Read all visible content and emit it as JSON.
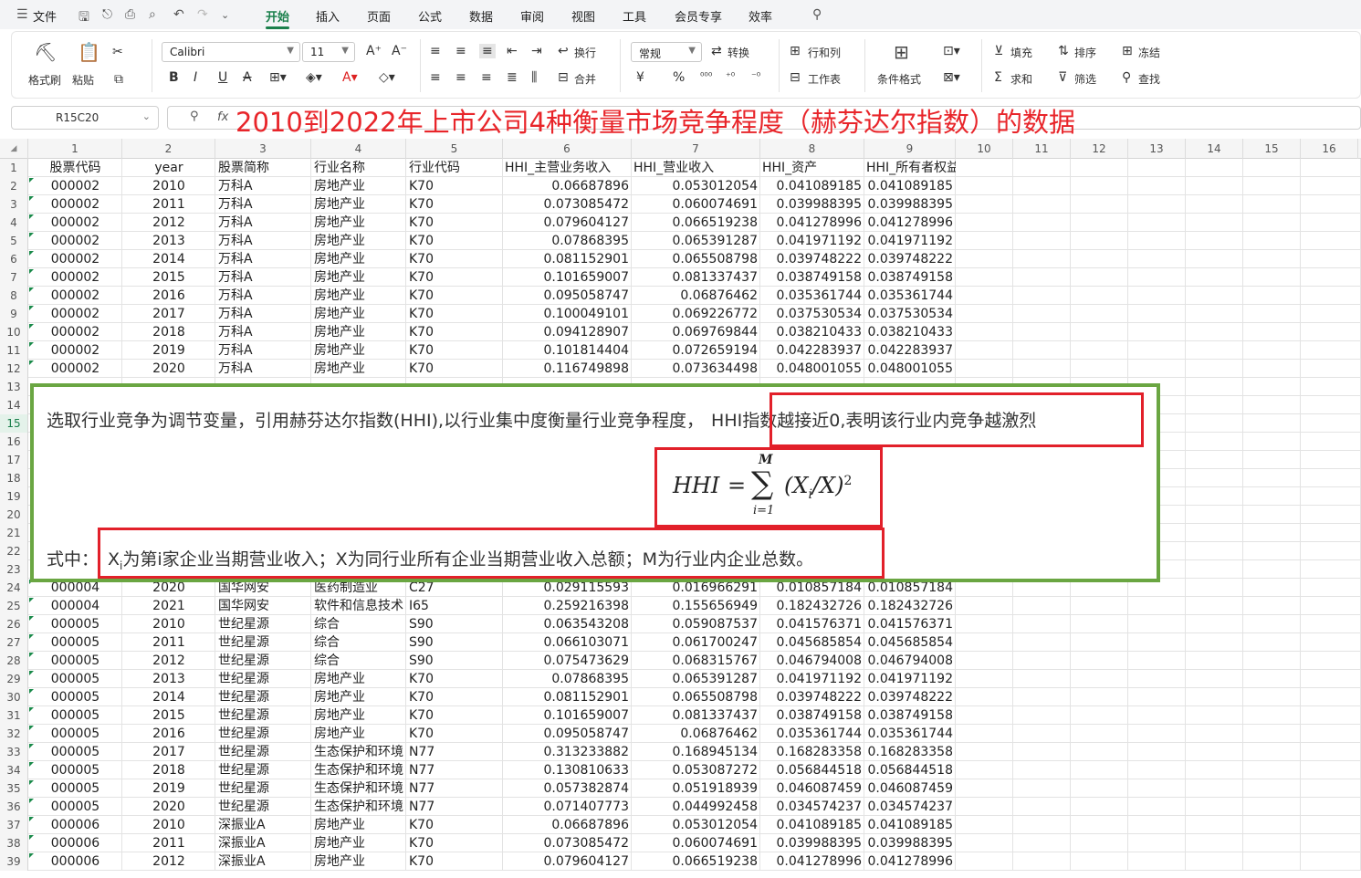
{
  "menu": {
    "file": "文件",
    "tabs": [
      "开始",
      "插入",
      "页面",
      "公式",
      "数据",
      "审阅",
      "视图",
      "工具",
      "会员专享",
      "效率"
    ],
    "active_tab": "开始"
  },
  "ribbon": {
    "format_painter": "格式刷",
    "paste": "粘贴",
    "font_name": "Calibri",
    "font_size": "11",
    "wrap": "换行",
    "merge": "合并",
    "number_format": "常规",
    "convert": "转换",
    "row_col": "行和列",
    "worksheet": "工作表",
    "cond_format": "条件格式",
    "fill": "填充",
    "sort": "排序",
    "freeze": "冻结",
    "sum": "求和",
    "filter": "筛选",
    "find": "查找",
    "yen": "¥",
    "percent": "%"
  },
  "formula_bar": {
    "name_box": "R15C20",
    "fx": "fx",
    "title": "2010到2022年上市公司4种衡量市场竞争程度（赫芬达尔指数）的数据"
  },
  "columns": [
    "1",
    "2",
    "3",
    "4",
    "5",
    "6",
    "7",
    "8",
    "9",
    "10",
    "11",
    "12",
    "13",
    "14",
    "15",
    "16"
  ],
  "row_numbers": [
    "1",
    "2",
    "3",
    "4",
    "5",
    "6",
    "7",
    "8",
    "9",
    "10",
    "11",
    "12",
    "13",
    "14",
    "15",
    "16",
    "17",
    "18",
    "19",
    "20",
    "21",
    "22",
    "23",
    "24",
    "25",
    "26",
    "27",
    "28",
    "29",
    "30",
    "31",
    "32",
    "33",
    "34",
    "35",
    "36",
    "37",
    "38",
    "39"
  ],
  "selected_row": "15",
  "header_row": [
    "股票代码",
    "year",
    "股票简称",
    "行业名称",
    "行业代码",
    "HHI_主营业务收入",
    "HHI_营业收入",
    "HHI_资产",
    "HHI_所有者权益"
  ],
  "rows_top": [
    [
      "000002",
      "2010",
      "万科A",
      "房地产业",
      "K70",
      "0.06687896",
      "0.053012054",
      "0.041089185",
      "0.041089185"
    ],
    [
      "000002",
      "2011",
      "万科A",
      "房地产业",
      "K70",
      "0.073085472",
      "0.060074691",
      "0.039988395",
      "0.039988395"
    ],
    [
      "000002",
      "2012",
      "万科A",
      "房地产业",
      "K70",
      "0.079604127",
      "0.066519238",
      "0.041278996",
      "0.041278996"
    ],
    [
      "000002",
      "2013",
      "万科A",
      "房地产业",
      "K70",
      "0.07868395",
      "0.065391287",
      "0.041971192",
      "0.041971192"
    ],
    [
      "000002",
      "2014",
      "万科A",
      "房地产业",
      "K70",
      "0.081152901",
      "0.065508798",
      "0.039748222",
      "0.039748222"
    ],
    [
      "000002",
      "2015",
      "万科A",
      "房地产业",
      "K70",
      "0.101659007",
      "0.081337437",
      "0.038749158",
      "0.038749158"
    ],
    [
      "000002",
      "2016",
      "万科A",
      "房地产业",
      "K70",
      "0.095058747",
      "0.06876462",
      "0.035361744",
      "0.035361744"
    ],
    [
      "000002",
      "2017",
      "万科A",
      "房地产业",
      "K70",
      "0.100049101",
      "0.069226772",
      "0.037530534",
      "0.037530534"
    ],
    [
      "000002",
      "2018",
      "万科A",
      "房地产业",
      "K70",
      "0.094128907",
      "0.069769844",
      "0.038210433",
      "0.038210433"
    ],
    [
      "000002",
      "2019",
      "万科A",
      "房地产业",
      "K70",
      "0.101814404",
      "0.072659194",
      "0.042283937",
      "0.042283937"
    ],
    [
      "000002",
      "2020",
      "万科A",
      "房地产业",
      "K70",
      "0.116749898",
      "0.073634498",
      "0.048001055",
      "0.048001055"
    ]
  ],
  "rows_bottom": [
    [
      "000004",
      "2020",
      "国华网安",
      "医药制造业",
      "C27",
      "0.029115593",
      "0.016966291",
      "0.010857184",
      "0.010857184"
    ],
    [
      "000004",
      "2021",
      "国华网安",
      "软件和信息技术",
      "I65",
      "0.259216398",
      "0.155656949",
      "0.182432726",
      "0.182432726"
    ],
    [
      "000005",
      "2010",
      "世纪星源",
      "综合",
      "S90",
      "0.063543208",
      "0.059087537",
      "0.041576371",
      "0.041576371"
    ],
    [
      "000005",
      "2011",
      "世纪星源",
      "综合",
      "S90",
      "0.066103071",
      "0.061700247",
      "0.045685854",
      "0.045685854"
    ],
    [
      "000005",
      "2012",
      "世纪星源",
      "综合",
      "S90",
      "0.075473629",
      "0.068315767",
      "0.046794008",
      "0.046794008"
    ],
    [
      "000005",
      "2013",
      "世纪星源",
      "房地产业",
      "K70",
      "0.07868395",
      "0.065391287",
      "0.041971192",
      "0.041971192"
    ],
    [
      "000005",
      "2014",
      "世纪星源",
      "房地产业",
      "K70",
      "0.081152901",
      "0.065508798",
      "0.039748222",
      "0.039748222"
    ],
    [
      "000005",
      "2015",
      "世纪星源",
      "房地产业",
      "K70",
      "0.101659007",
      "0.081337437",
      "0.038749158",
      "0.038749158"
    ],
    [
      "000005",
      "2016",
      "世纪星源",
      "房地产业",
      "K70",
      "0.095058747",
      "0.06876462",
      "0.035361744",
      "0.035361744"
    ],
    [
      "000005",
      "2017",
      "世纪星源",
      "生态保护和环境",
      "N77",
      "0.313233882",
      "0.168945134",
      "0.168283358",
      "0.168283358"
    ],
    [
      "000005",
      "2018",
      "世纪星源",
      "生态保护和环境",
      "N77",
      "0.130810633",
      "0.053087272",
      "0.056844518",
      "0.056844518"
    ],
    [
      "000005",
      "2019",
      "世纪星源",
      "生态保护和环境",
      "N77",
      "0.057382874",
      "0.051918939",
      "0.046087459",
      "0.046087459"
    ],
    [
      "000005",
      "2020",
      "世纪星源",
      "生态保护和环境",
      "N77",
      "0.071407773",
      "0.044992458",
      "0.034574237",
      "0.034574237"
    ],
    [
      "000006",
      "2010",
      "深振业A",
      "房地产业",
      "K70",
      "0.06687896",
      "0.053012054",
      "0.041089185",
      "0.041089185"
    ],
    [
      "000006",
      "2011",
      "深振业A",
      "房地产业",
      "K70",
      "0.073085472",
      "0.060074691",
      "0.039988395",
      "0.039988395"
    ],
    [
      "000006",
      "2012",
      "深振业A",
      "房地产业",
      "K70",
      "0.079604127",
      "0.066519238",
      "0.041278996",
      "0.041278996"
    ]
  ],
  "overlay": {
    "line1_a": "选取行业竞争为调节变量，引用赫芬达尔指数(HHI),以行业集中度衡量行业竞争程度，",
    "line1_b": "HHI指数越接近0,表明该行业内竞争越激烈",
    "formula_lhs": "HHI",
    "formula_eq": "=",
    "formula_sum": "∑",
    "formula_top": "M",
    "formula_bottom": "i=1",
    "formula_body": "(X",
    "formula_sub": "i",
    "formula_body2": "/X)",
    "formula_exp": "2",
    "line2_a": "式中：",
    "line2_b1": "X",
    "line2_b_sub": "i",
    "line2_b2": "为第i家企业当期营业收入；X为同行业所有企业当期营业收入总额；M为行业内企业总数。"
  },
  "colors": {
    "accent": "#1a7f4b",
    "title_red": "#e8252a",
    "frame_green": "#6aa642",
    "box_red": "#e2202a"
  }
}
